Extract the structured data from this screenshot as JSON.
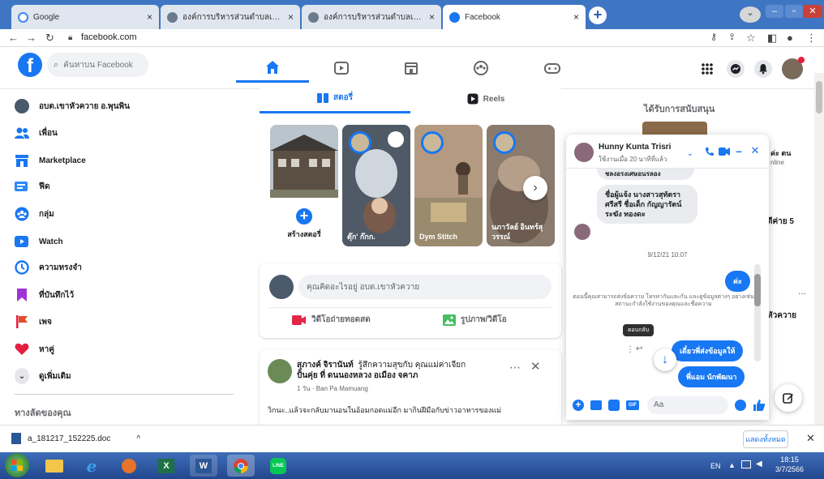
{
  "browser": {
    "tabs": [
      {
        "title": "Google"
      },
      {
        "title": "องค์การบริหารส่วนตำบลเขาหัวควาย ×"
      },
      {
        "title": "องค์การบริหารส่วนตำบลเขาหัวควาย ×"
      },
      {
        "title": "Facebook"
      }
    ],
    "url": "facebook.com"
  },
  "fb": {
    "search_placeholder": "ค้นหาบน Facebook"
  },
  "sidebar": {
    "items": [
      {
        "label": "อบต.เขาหัวควาย อ.พุนพิน",
        "icon": "profile-avatar"
      },
      {
        "label": "เพื่อน",
        "icon": "friends-icon"
      },
      {
        "label": "Marketplace",
        "icon": "marketplace-icon"
      },
      {
        "label": "ฟีด",
        "icon": "feed-icon"
      },
      {
        "label": "กลุ่ม",
        "icon": "groups-icon"
      },
      {
        "label": "Watch",
        "icon": "watch-icon"
      },
      {
        "label": "ความทรงจำ",
        "icon": "memories-icon"
      },
      {
        "label": "ที่บันทึกไว้",
        "icon": "saved-icon"
      },
      {
        "label": "เพจ",
        "icon": "pages-icon"
      },
      {
        "label": "หาคู่",
        "icon": "dating-icon"
      },
      {
        "label": "ดูเพิ่มเติม",
        "icon": "chevron-down-icon"
      }
    ],
    "shortcuts_title": "ทางลัดของคุณ"
  },
  "feed": {
    "tab_stories": "สตอรี่",
    "tab_reels": "Reels",
    "stories": [
      {
        "name": "สร้างสตอรี่"
      },
      {
        "name": "ตุ๊ก' ก๊กก."
      },
      {
        "name": "Dym Stitch"
      },
      {
        "name": "นภาวัลย์ อินทร์สุวรรณ์"
      }
    ],
    "composer_placeholder": "คุณคิดอะไรอยู่ อบต.เขาหัวควาย",
    "live_video": "วิดีโอถ่ายทอดสด",
    "photo_video": "รูปภาพ/วิดีโอ",
    "post": {
      "author": "สุภางค์ จิรานันท์",
      "feeling": "รู้สึกความสุขกับ คุณแม่ค่าเจียก",
      "with": "ปั้นคุ่ย ที่ ดนนองหลวง อเมือง จคาภ",
      "meta": "1 วัน · Ban Pa Mamuang",
      "text": "วิกนะ..แล้วจะกลับมานอนในอ้อมกอดแม่อีก มากินฝีมือกับข่าวอาหารของแม่"
    }
  },
  "right": {
    "sponsored_title": "ได้รับการสนับสนุน",
    "fragment_1": "ค่ะ ตน",
    "fragment_2": "nline",
    "fragment_3": "ตีค่าย 5",
    "fragment_4": "หัวควาย",
    "more": "..."
  },
  "chat": {
    "name": "Hunny Kunta Trisri",
    "status": "ใช้งานเมื่อ 20 นาทีที่แล้ว",
    "msg_top": "ชลงอรงเศษอนรลอง",
    "msg_1": "ชื่อผู้แจ้ง นางสาวสุทัตรา ศรีสรี ชื่อเด็ก กัญญารัตน์ ระฆัง ทองดะ",
    "timestamp": "9/12/21 10:07",
    "msg_out_1": "ค่ะ",
    "system_text": "ตอนนี้คุณสามารถส่งข้อความ โทรหากันและกัน และดูข้อมูลต่างๆ อย่างเช่น สถานะกำลังใช้งานของคุณและชื่อความ",
    "tooltip": "ตอบกลับ",
    "msg_out_2": "เดี๋ยวพี่ส่งข้อมูลให้",
    "msg_out_3": "พี่แอม นักพัฒนา",
    "input_placeholder": "Aa"
  },
  "downloads": {
    "file": "a_181217_152225.doc",
    "show_all": "แสดงทั้งหมด"
  },
  "taskbar": {
    "lang": "EN",
    "time": "18:15",
    "date": "3/7/2566"
  },
  "colors": {
    "fb_blue": "#1877f2",
    "taskbar": "#2f5ba5"
  }
}
